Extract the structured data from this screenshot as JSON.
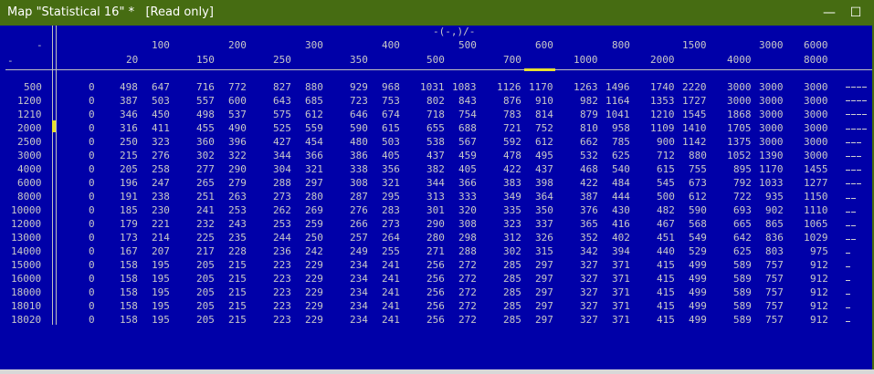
{
  "window": {
    "title": "Map \"Statistical 16\" *   [Read only]",
    "minimize_glyph": "—",
    "maximize_glyph": "☐"
  },
  "axis": {
    "corner_label": "-(-,)/-",
    "row_header_top": "-",
    "row_header_bottom": "-",
    "x_top": [
      "100",
      "200",
      "300",
      "400",
      "500",
      "600",
      "800",
      "1500",
      "3000",
      "6000"
    ],
    "x_bottom": [
      "20",
      "150",
      "250",
      "350",
      "500",
      "700",
      "1000",
      "2000",
      "4000",
      "8000"
    ],
    "x_first": "0"
  },
  "rows": [
    {
      "y": "500",
      "vals": [
        "0",
        "498",
        "647",
        "716",
        "772",
        "827",
        "880",
        "929",
        "968",
        "1031",
        "1083",
        "1126",
        "1170",
        "1263",
        "1496",
        "1740",
        "2220",
        "3000",
        "3000",
        "3000"
      ]
    },
    {
      "y": "1200",
      "vals": [
        "0",
        "387",
        "503",
        "557",
        "600",
        "643",
        "685",
        "723",
        "753",
        "802",
        "843",
        "876",
        "910",
        "982",
        "1164",
        "1353",
        "1727",
        "3000",
        "3000",
        "3000"
      ]
    },
    {
      "y": "1210",
      "vals": [
        "0",
        "346",
        "450",
        "498",
        "537",
        "575",
        "612",
        "646",
        "674",
        "718",
        "754",
        "783",
        "814",
        "879",
        "1041",
        "1210",
        "1545",
        "1868",
        "3000",
        "3000"
      ]
    },
    {
      "y": "2000",
      "vals": [
        "0",
        "316",
        "411",
        "455",
        "490",
        "525",
        "559",
        "590",
        "615",
        "655",
        "688",
        "721",
        "752",
        "810",
        "958",
        "1109",
        "1410",
        "1705",
        "3000",
        "3000"
      ]
    },
    {
      "y": "2500",
      "vals": [
        "0",
        "250",
        "323",
        "360",
        "396",
        "427",
        "454",
        "480",
        "503",
        "538",
        "567",
        "592",
        "612",
        "662",
        "785",
        "900",
        "1142",
        "1375",
        "3000",
        "3000"
      ]
    },
    {
      "y": "3000",
      "vals": [
        "0",
        "215",
        "276",
        "302",
        "322",
        "344",
        "366",
        "386",
        "405",
        "437",
        "459",
        "478",
        "495",
        "532",
        "625",
        "712",
        "880",
        "1052",
        "1390",
        "3000"
      ]
    },
    {
      "y": "4000",
      "vals": [
        "0",
        "205",
        "258",
        "277",
        "290",
        "304",
        "321",
        "338",
        "356",
        "382",
        "405",
        "422",
        "437",
        "468",
        "540",
        "615",
        "755",
        "895",
        "1170",
        "1455"
      ]
    },
    {
      "y": "6000",
      "vals": [
        "0",
        "196",
        "247",
        "265",
        "279",
        "288",
        "297",
        "308",
        "321",
        "344",
        "366",
        "383",
        "398",
        "422",
        "484",
        "545",
        "673",
        "792",
        "1033",
        "1277"
      ]
    },
    {
      "y": "8000",
      "vals": [
        "0",
        "191",
        "238",
        "251",
        "263",
        "273",
        "280",
        "287",
        "295",
        "313",
        "333",
        "349",
        "364",
        "387",
        "444",
        "500",
        "612",
        "722",
        "935",
        "1150"
      ]
    },
    {
      "y": "10000",
      "vals": [
        "0",
        "185",
        "230",
        "241",
        "253",
        "262",
        "269",
        "276",
        "283",
        "301",
        "320",
        "335",
        "350",
        "376",
        "430",
        "482",
        "590",
        "693",
        "902",
        "1110"
      ]
    },
    {
      "y": "12000",
      "vals": [
        "0",
        "179",
        "221",
        "232",
        "243",
        "253",
        "259",
        "266",
        "273",
        "290",
        "308",
        "323",
        "337",
        "365",
        "416",
        "467",
        "568",
        "665",
        "865",
        "1065"
      ]
    },
    {
      "y": "13000",
      "vals": [
        "0",
        "173",
        "214",
        "225",
        "235",
        "244",
        "250",
        "257",
        "264",
        "280",
        "298",
        "312",
        "326",
        "352",
        "402",
        "451",
        "549",
        "642",
        "836",
        "1029"
      ]
    },
    {
      "y": "14000",
      "vals": [
        "0",
        "167",
        "207",
        "217",
        "228",
        "236",
        "242",
        "249",
        "255",
        "271",
        "288",
        "302",
        "315",
        "342",
        "394",
        "440",
        "529",
        "625",
        "803",
        "975"
      ]
    },
    {
      "y": "15000",
      "vals": [
        "0",
        "158",
        "195",
        "205",
        "215",
        "223",
        "229",
        "234",
        "241",
        "256",
        "272",
        "285",
        "297",
        "327",
        "371",
        "415",
        "499",
        "589",
        "757",
        "912"
      ]
    },
    {
      "y": "16000",
      "vals": [
        "0",
        "158",
        "195",
        "205",
        "215",
        "223",
        "229",
        "234",
        "241",
        "256",
        "272",
        "285",
        "297",
        "327",
        "371",
        "415",
        "499",
        "589",
        "757",
        "912"
      ]
    },
    {
      "y": "18000",
      "vals": [
        "0",
        "158",
        "195",
        "205",
        "215",
        "223",
        "229",
        "234",
        "241",
        "256",
        "272",
        "285",
        "297",
        "327",
        "371",
        "415",
        "499",
        "589",
        "757",
        "912"
      ]
    },
    {
      "y": "18010",
      "vals": [
        "0",
        "158",
        "195",
        "205",
        "215",
        "223",
        "229",
        "234",
        "241",
        "256",
        "272",
        "285",
        "297",
        "327",
        "371",
        "415",
        "499",
        "589",
        "757",
        "912"
      ]
    },
    {
      "y": "18020",
      "vals": [
        "0",
        "158",
        "195",
        "205",
        "215",
        "223",
        "229",
        "234",
        "241",
        "256",
        "272",
        "285",
        "297",
        "327",
        "371",
        "415",
        "499",
        "589",
        "757",
        "912"
      ]
    }
  ],
  "colors": {
    "background": "#0000a8",
    "titlebar": "#466c12",
    "text": "#c8c8c8",
    "cursor": "#e8e030"
  }
}
